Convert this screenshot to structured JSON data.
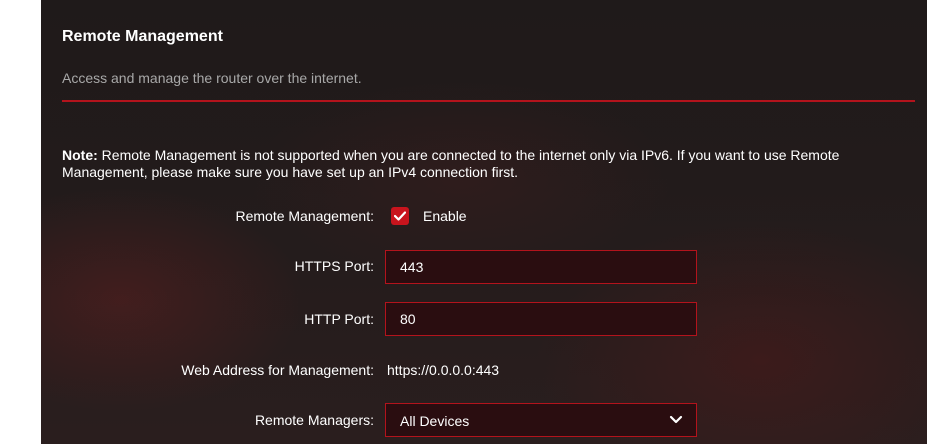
{
  "section": {
    "title": "Remote Management",
    "subtitle": "Access and manage the router over the internet."
  },
  "note": {
    "prefix": "Note:",
    "text": " Remote Management is not supported when you are connected to the internet only via IPv6. If you want to use Remote Management, please make sure you have set up an IPv4 connection first."
  },
  "form": {
    "remote_management": {
      "label": "Remote Management:",
      "checkbox_label": "Enable",
      "checked": true
    },
    "https_port": {
      "label": "HTTPS Port:",
      "value": "443"
    },
    "http_port": {
      "label": "HTTP Port:",
      "value": "80"
    },
    "web_address": {
      "label": "Web Address for Management:",
      "value": "https://0.0.0.0:443"
    },
    "remote_managers": {
      "label": "Remote Managers:",
      "selected": "All Devices"
    }
  },
  "colors": {
    "accent": "#b3131c",
    "checkbox": "#c8141d",
    "field_bg": "#2a0d10"
  },
  "icons": {
    "checkbox": "check-icon",
    "dropdown": "chevron-down-icon"
  }
}
